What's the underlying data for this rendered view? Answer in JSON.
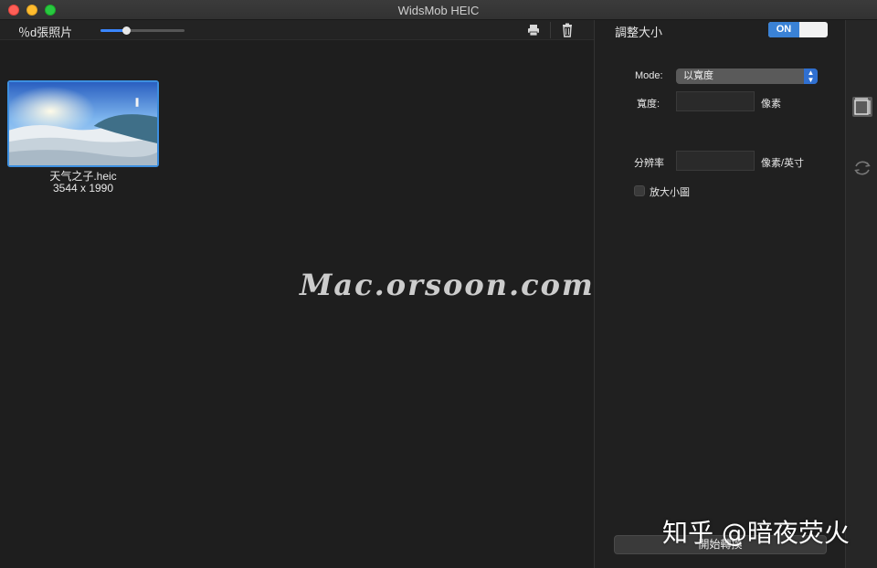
{
  "window": {
    "title": "WidsMob HEIC"
  },
  "toolbar": {
    "photo_count_label": "％d張照片",
    "thumbnail_size_fraction": 0.3,
    "print_icon": "printer-icon",
    "delete_icon": "trash-icon"
  },
  "files": [
    {
      "name": "天气之子.heic",
      "dimensions": "3544 x 1990",
      "selected": true
    }
  ],
  "watermark": "Mac.orsoon.com",
  "resize_panel": {
    "title": "調整大小",
    "toggle_label": "ON",
    "enabled": true,
    "mode_label": "Mode:",
    "mode_value": "以寬度",
    "width_label": "寬度:",
    "width_value": "",
    "width_unit": "像素",
    "resolution_label": "分辨率",
    "resolution_value": "",
    "resolution_unit": "像素/英寸",
    "enlarge_label": "放大小圖",
    "enlarge_checked": false,
    "start_button": "開始轉換"
  },
  "rail": {
    "items": [
      "resize-icon",
      "rotate-icon"
    ]
  },
  "credit": "知乎 @暗夜荧火",
  "colors": {
    "accent": "#3a82d6",
    "selection": "#3d8fe0"
  }
}
